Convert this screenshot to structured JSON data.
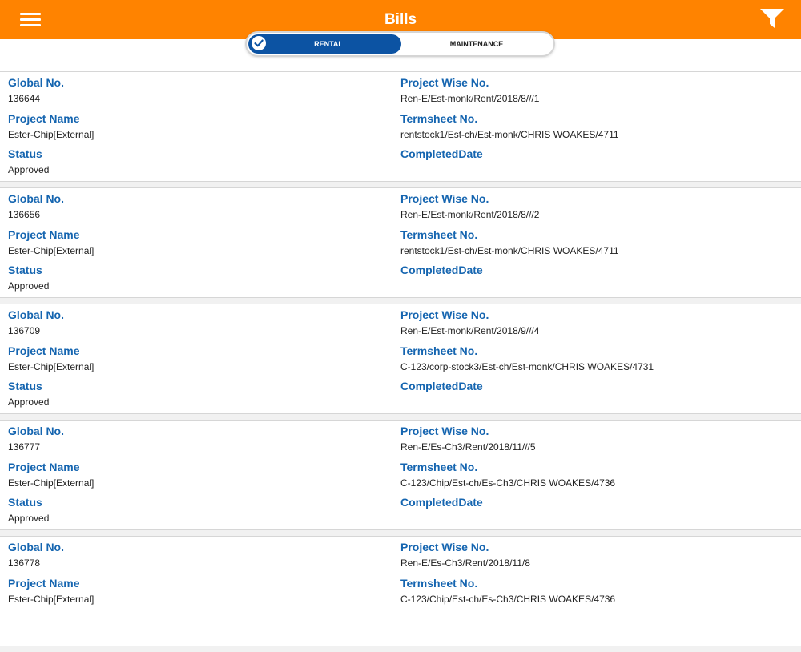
{
  "header": {
    "title": "Bills",
    "menu_icon": "hamburger-menu-icon",
    "filter_icon": "filter-funnel-icon",
    "background_color": "#ff8300"
  },
  "tabs": {
    "rental_label": "RENTAL",
    "maintenance_label": "MAINTENANCE",
    "selected": "RENTAL",
    "selected_color": "#0c53a3"
  },
  "labels": {
    "global_no": "Global No.",
    "project_name": "Project Name",
    "status": "Status",
    "project_wise_no": "Project Wise No.",
    "termsheet_no": "Termsheet No.",
    "completed_date": "CompletedDate"
  },
  "bills": [
    {
      "global_no": "136644",
      "project_name": "Ester-Chip[External]",
      "status": "Approved",
      "project_wise_no": "Ren-E/Est-monk/Rent/2018/8///1",
      "termsheet_no": "rentstock1/Est-ch/Est-monk/CHRIS WOAKES/4711",
      "completed_date": ""
    },
    {
      "global_no": "136656",
      "project_name": "Ester-Chip[External]",
      "status": "Approved",
      "project_wise_no": "Ren-E/Est-monk/Rent/2018/8///2",
      "termsheet_no": "rentstock1/Est-ch/Est-monk/CHRIS WOAKES/4711",
      "completed_date": ""
    },
    {
      "global_no": "136709",
      "project_name": "Ester-Chip[External]",
      "status": "Approved",
      "project_wise_no": "Ren-E/Est-monk/Rent/2018/9///4",
      "termsheet_no": "C-123/corp-stock3/Est-ch/Est-monk/CHRIS WOAKES/4731",
      "completed_date": ""
    },
    {
      "global_no": "136777",
      "project_name": "Ester-Chip[External]",
      "status": "Approved",
      "project_wise_no": "Ren-E/Es-Ch3/Rent/2018/11///5",
      "termsheet_no": "C-123/Chip/Est-ch/Es-Ch3/CHRIS WOAKES/4736",
      "completed_date": ""
    },
    {
      "global_no": "136778",
      "project_name": "Ester-Chip[External]",
      "status": "",
      "project_wise_no": "Ren-E/Es-Ch3/Rent/2018/11/8",
      "termsheet_no": "C-123/Chip/Est-ch/Es-Ch3/CHRIS WOAKES/4736",
      "completed_date": ""
    }
  ]
}
